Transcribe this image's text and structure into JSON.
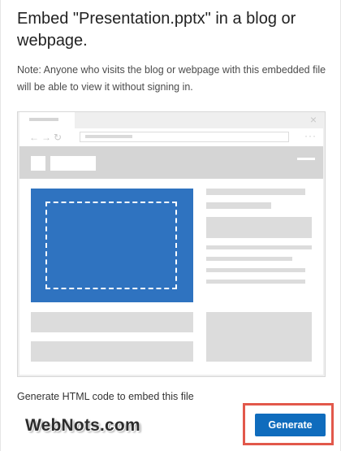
{
  "dialog": {
    "title": "Embed \"Presentation.pptx\" in a blog or webpage.",
    "note": "Note: Anyone who visits the blog or webpage with this embedded file will be able to view it without signing in.",
    "footer_label": "Generate HTML code to embed this file",
    "generate_label": "Generate"
  },
  "illustration": {
    "close_glyph": "×",
    "nav_glyphs": "←→↻",
    "menu_glyph": "···",
    "slide_color": "#2f73c0"
  },
  "watermark": {
    "text": "WebNots.com"
  },
  "colors": {
    "button": "#0f6cbd",
    "highlight_border": "#e2584b"
  }
}
